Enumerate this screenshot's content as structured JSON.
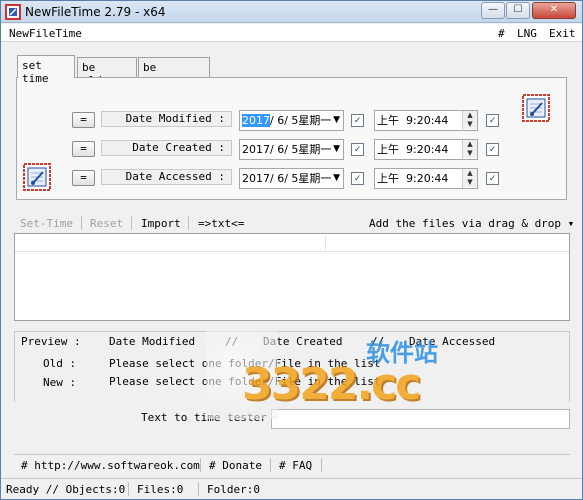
{
  "window": {
    "title": "NewFileTime 2.79 - x64",
    "controls": {
      "minimize": "—",
      "maximize": "☐",
      "close": "✕"
    }
  },
  "menu": {
    "app_name": "NewFileTime",
    "hash": "#",
    "lng": "LNG",
    "exit": "Exit"
  },
  "tabs": [
    {
      "label": "set time",
      "active": true
    },
    {
      "label": "be older",
      "active": false
    },
    {
      "label": "be younger",
      "active": false
    }
  ],
  "rows": [
    {
      "eq": "=",
      "label": "Date Modified :",
      "date_selected": "2017",
      "date_rest": "/ 6/ 5星期一",
      "ampm": "上午",
      "time": "9:20:44",
      "date_checked": true,
      "time_checked": true
    },
    {
      "eq": "=",
      "label": "Date Created :",
      "date_selected": "",
      "date_rest": "2017/ 6/ 5星期一",
      "ampm": "上午",
      "time": "9:20:44",
      "date_checked": true,
      "time_checked": true
    },
    {
      "eq": "=",
      "label": "Date Accessed :",
      "date_selected": "",
      "date_rest": "2017/ 6/ 5星期一",
      "ampm": "上午",
      "time": "9:20:44",
      "date_checked": true,
      "time_checked": true
    }
  ],
  "toolbar": {
    "set_time": "Set-Time",
    "reset": "Reset",
    "import": "Import",
    "to_txt": "=>txt<=",
    "add_files": "Add the files via drag & drop ▾"
  },
  "preview": {
    "label": "Preview :",
    "col_modified": "Date Modified",
    "sep1": "//",
    "col_created": "Date Created",
    "sep2": "//",
    "col_accessed": "Date Accessed",
    "old_label": "Old :",
    "new_label": "New :",
    "old_value": "Please select one folder/File in the list",
    "new_value": "Please select one folder/File in the list"
  },
  "tester": {
    "label": "Text to time tester",
    "value": ""
  },
  "links": {
    "website": "# http://www.softwareok.com",
    "donate": "# Donate",
    "faq": "# FAQ"
  },
  "status": {
    "ready": "Ready // Objects:0",
    "files": "Files:0",
    "folder": "Folder:0"
  },
  "watermark": {
    "text": "软件站",
    "domain": "3322.cc"
  },
  "colors": {
    "selection": "#3399ff",
    "accent_blue": "#1f4fa0",
    "accent_red": "#d23b2b"
  }
}
